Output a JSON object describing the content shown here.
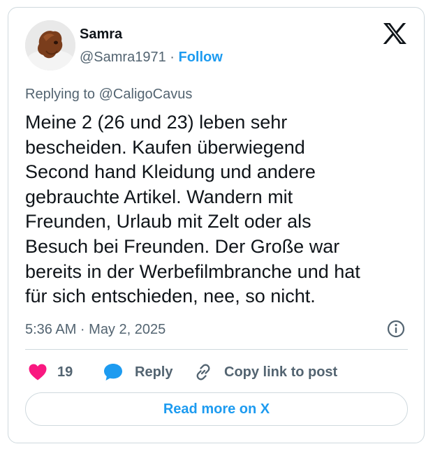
{
  "author": {
    "name": "Samra",
    "handle": "@Samra1971",
    "separator": "·",
    "follow_label": "Follow"
  },
  "reply_context": {
    "prefix": "Replying to",
    "mention": "@CaligoCavus"
  },
  "tweet": {
    "lines": [
      "Meine 2 (26 und 23) leben sehr",
      "bescheiden. Kaufen überwiegend",
      "Second hand Kleidung und andere",
      "gebrauchte Artikel. Wandern mit",
      "Freunden, Urlaub mit Zelt oder als",
      "Besuch bei Freunden. Der Große war",
      "bereits in der Werbefilmbranche und hat",
      "für sich entschieden, nee, so nicht."
    ],
    "timestamp": "5:36 AM · May 2, 2025"
  },
  "actions": {
    "like_count": "19",
    "reply_label": "Reply",
    "copy_label": "Copy link to post"
  },
  "read_more_label": "Read more on X",
  "icons": {
    "logo": "x-logo-icon",
    "info": "info-icon",
    "like": "heart-icon",
    "reply": "speech-bubble-icon",
    "copy": "link-icon"
  },
  "colors": {
    "accent": "#1d9bf0",
    "like": "#f91880",
    "secondary_text": "#536471",
    "border": "#cfd9de"
  }
}
